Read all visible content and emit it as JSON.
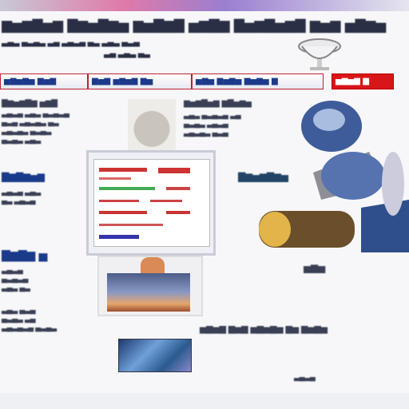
{
  "colors": {
    "brand_blue": "#1a3a8a",
    "accent_red": "#d8161a",
    "nav_border": "#bb2233"
  },
  "icons": {
    "cup": "cup-icon",
    "cart": "shopping-cart-icon"
  }
}
